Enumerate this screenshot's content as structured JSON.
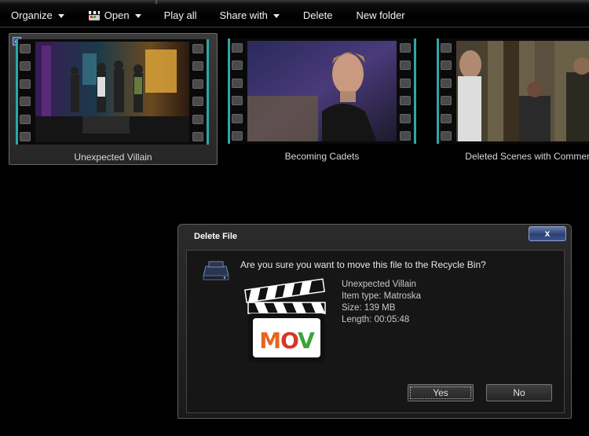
{
  "toolbar": {
    "organize": "Organize",
    "open": "Open",
    "play_all": "Play all",
    "share_with": "Share with",
    "delete": "Delete",
    "new_folder": "New folder"
  },
  "thumbnails": [
    {
      "label": "Unexpected Villain",
      "selected": true
    },
    {
      "label": "Becoming Cadets",
      "selected": false
    },
    {
      "label": "Deleted Scenes with Commen",
      "selected": false
    }
  ],
  "dialog": {
    "title": "Delete File",
    "close": "x",
    "question": "Are you sure you want to move this file to the Recycle Bin?",
    "file_icon_text": "MOV",
    "file_name": "Unexpected Villain",
    "item_type": "Item type: Matroska",
    "size": "Size: 139 MB",
    "length": "Length: 00:05:48",
    "yes": "Yes",
    "no": "No"
  },
  "colors": {
    "film_edge": "#2fa6a6",
    "close_button": "#2a3f73"
  }
}
